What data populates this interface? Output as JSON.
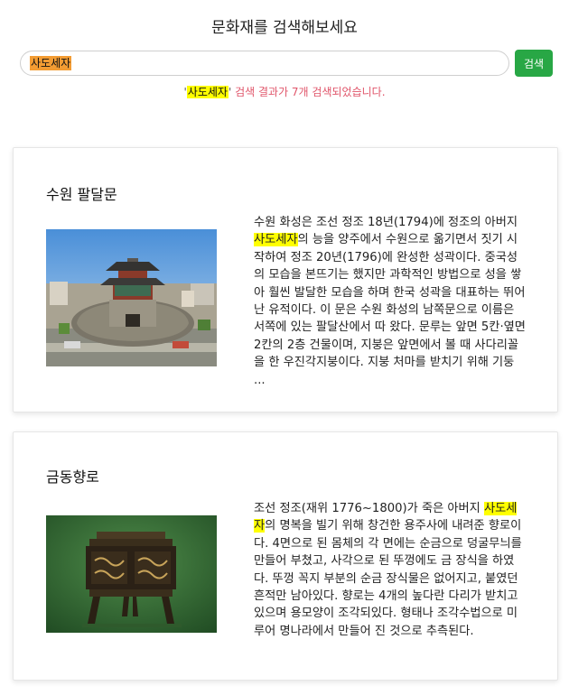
{
  "header": {
    "title": "문화재를 검색해보세요"
  },
  "search": {
    "value": "사도세자",
    "button_label": "검색"
  },
  "result": {
    "quote_open": "'",
    "keyword": "사도세자",
    "quote_close": "'",
    "message": " 검색 결과가 7개 검색되었습니다."
  },
  "colors": {
    "accent_green": "#28a745",
    "highlight_yellow": "#ffff00",
    "selection_orange": "#f39c33",
    "message_red": "#e0556a"
  },
  "items": [
    {
      "title": "수원 팔달문",
      "image": "palace-gate-photo",
      "desc_before": "수원 화성은 조선 정조 18년(1794)에 정조의 아버지 ",
      "desc_keyword": "사도세자",
      "desc_after": "의 능을 양주에서 수원으로 옮기면서 짓기 시작하여 정조 20년(1796)에 완성한 성곽이다. 중국성의 모습을 본뜨기는 했지만 과학적인 방법으로 성을 쌓아 훨씬 발달한 모습을 하며 한국 성곽을 대표하는 뛰어난 유적이다. 이 문은 수원 화성의 남쪽문으로 이름은 서쪽에 있는 팔달산에서 따 왔다. 문루는 앞면 5칸·옆면 2칸의 2층 건물이며, 지붕은 앞면에서 볼 때 사다리꼴을 한 우진각지붕이다. 지붕 처마를 받치기 위해 기둥 ..."
    },
    {
      "title": "금동향로",
      "image": "incense-burner-photo",
      "desc_before": "조선 정조(재위 1776~1800)가 죽은 아버지 ",
      "desc_keyword": "사도세자",
      "desc_after": "의 명복을 빌기 위해 창건한 용주사에 내려준 향로이다. 4면으로 된 몸체의 각 면에는 순금으로 덩굴무늬를 만들어 부쳤고, 사각으로 된 뚜껑에도 금 장식을 하였다. 뚜껑 꼭지 부분의 순금 장식물은 없어지고, 붙였던 흔적만 남아있다. 향로는 4개의 높다란 다리가 받치고 있으며 용모양이 조각되있다. 형태나 조각수법으로 미루어 명나라에서 만들어 진 것으로 추측된다."
    }
  ]
}
